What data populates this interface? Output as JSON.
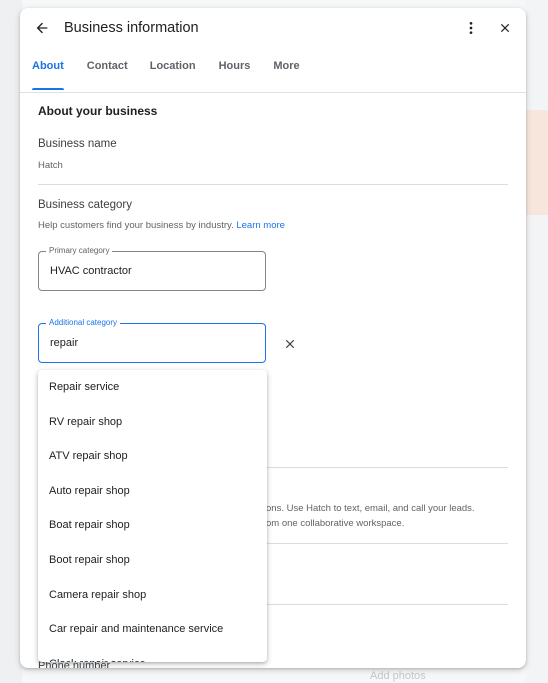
{
  "dialog": {
    "title": "Business information",
    "icons": {
      "back": "arrow-back-icon",
      "more": "more-vert-icon",
      "close": "close-icon"
    }
  },
  "tabs": [
    {
      "label": "About",
      "active": true
    },
    {
      "label": "Contact",
      "active": false
    },
    {
      "label": "Location",
      "active": false
    },
    {
      "label": "Hours",
      "active": false
    },
    {
      "label": "More",
      "active": false
    }
  ],
  "about": {
    "heading": "About your business",
    "business_name_label": "Business name",
    "business_name_value": "Hatch",
    "category_label": "Business category",
    "category_help": "Help customers find your business by industry.",
    "learn_more": "Learn more",
    "primary_category": {
      "legend": "Primary category",
      "value": "HVAC contractor"
    },
    "additional_category": {
      "legend": "Additional category",
      "value": "repair"
    },
    "description_partial_1": "ons. Use Hatch to text, email, and call your leads.",
    "description_partial_2": "om one collaborative workspace."
  },
  "dropdown": {
    "options": [
      "Repair service",
      "RV repair shop",
      "ATV repair shop",
      "Auto repair shop",
      "Boat repair shop",
      "Boot repair shop",
      "Camera repair shop",
      "Car repair and maintenance service",
      "Clock repair service"
    ]
  },
  "footer": {
    "phone_label": "Phone number"
  },
  "background": {
    "add_photos": "Add photos"
  },
  "colors": {
    "accent": "#1a73e8",
    "text_primary": "#202124",
    "text_secondary": "#5f6368"
  }
}
